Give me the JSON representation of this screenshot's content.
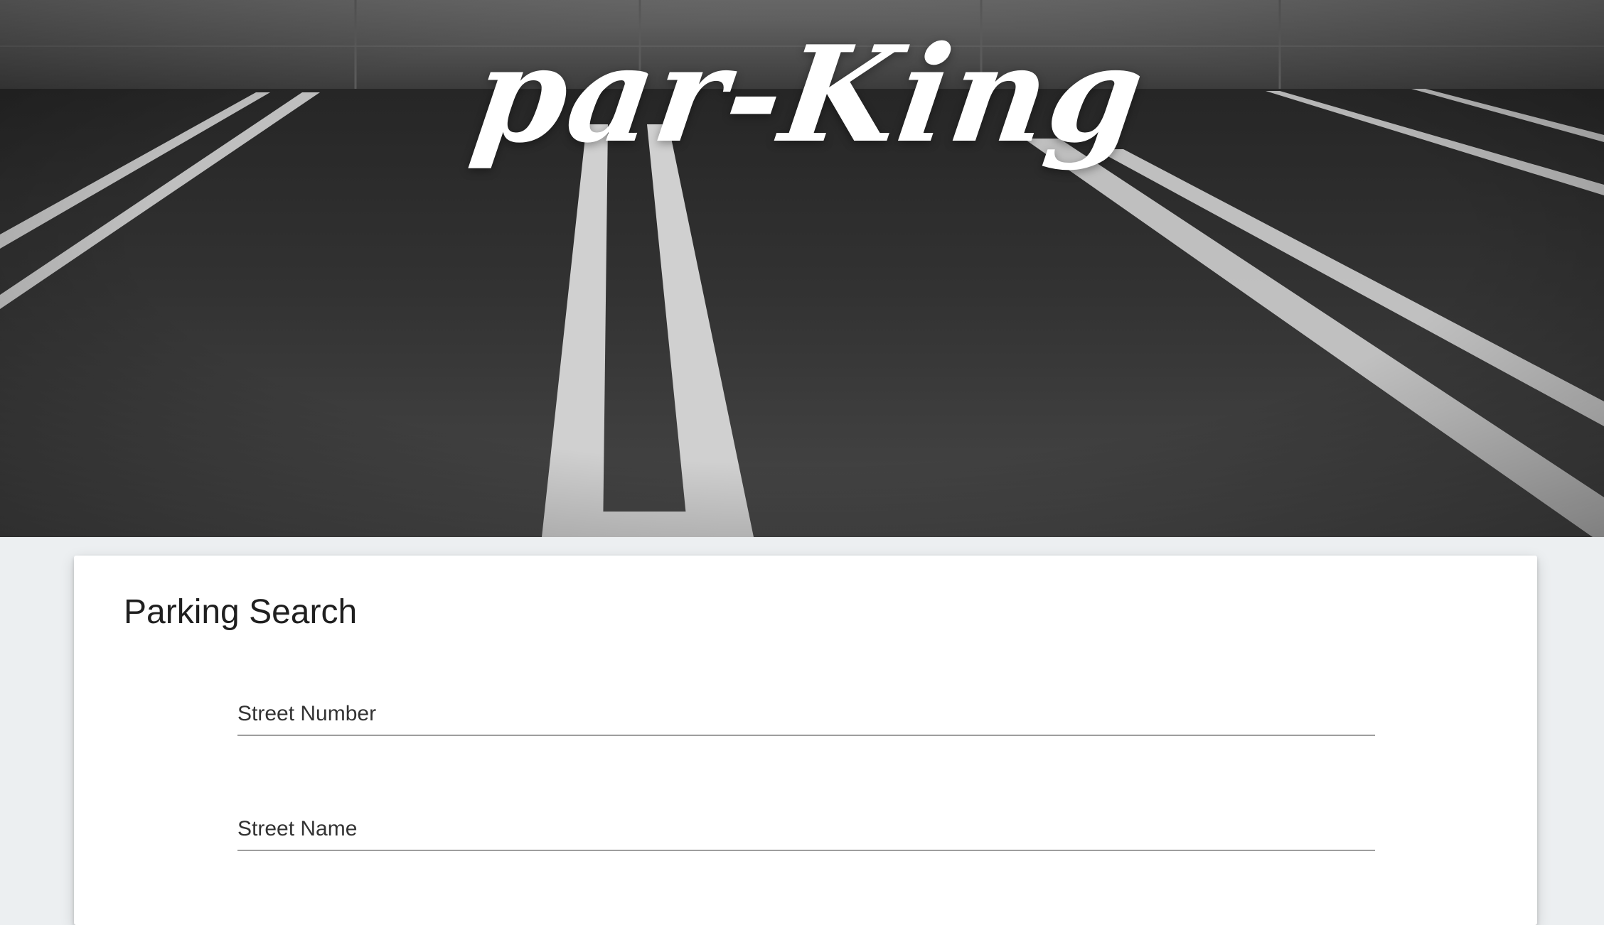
{
  "hero": {
    "logo_text": "par-King",
    "background": "parking-lot-photo"
  },
  "search_card": {
    "title": "Parking Search",
    "fields": [
      {
        "label": "Street Number",
        "value": "",
        "placeholder": ""
      },
      {
        "label": "Street Name",
        "value": "",
        "placeholder": ""
      }
    ]
  },
  "colors": {
    "page_background": "#eceff1",
    "card_background": "#ffffff",
    "field_underline": "#9e9e9e",
    "logo": "#ffffff"
  }
}
